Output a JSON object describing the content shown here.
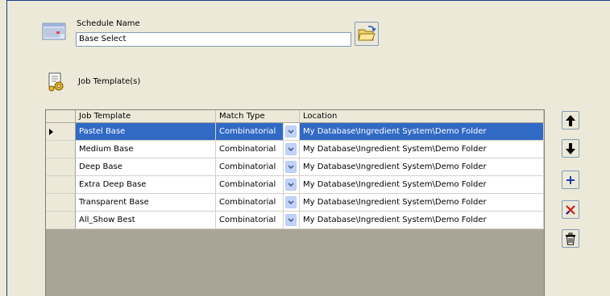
{
  "schedule": {
    "label": "Schedule Name",
    "value": "Base Select"
  },
  "templates_section": {
    "label": "Job Template(s)"
  },
  "grid": {
    "columns": [
      "Job Template",
      "Match Type",
      "Location"
    ],
    "rows": [
      {
        "template": "Pastel Base",
        "match": "Combinatorial",
        "location": "My Database\\Ingredient System\\Demo Folder",
        "selected": true
      },
      {
        "template": "Medium Base",
        "match": "Combinatorial",
        "location": "My Database\\Ingredient System\\Demo Folder"
      },
      {
        "template": "Deep Base",
        "match": "Combinatorial",
        "location": "My Database\\Ingredient System\\Demo Folder"
      },
      {
        "template": "Extra Deep Base",
        "match": "Combinatorial",
        "location": "My Database\\Ingredient System\\Demo Folder"
      },
      {
        "template": "Transparent Base",
        "match": "Combinatorial",
        "location": "My Database\\Ingredient System\\Demo Folder"
      },
      {
        "template": "All_Show Best",
        "match": "Combinatorial",
        "location": "My Database\\Ingredient System\\Demo Folder"
      }
    ]
  },
  "side_buttons": [
    {
      "name": "move-up-button",
      "icon": "arrow-up-icon"
    },
    {
      "name": "move-down-button",
      "icon": "arrow-down-icon"
    },
    {
      "name": "add-button",
      "icon": "plus-icon"
    },
    {
      "name": "remove-button",
      "icon": "x-icon"
    },
    {
      "name": "delete-button",
      "icon": "trash-icon"
    }
  ],
  "colors": {
    "selection": "#316ac5",
    "panel": "#ece9d8",
    "grid_empty": "#a9a496"
  }
}
